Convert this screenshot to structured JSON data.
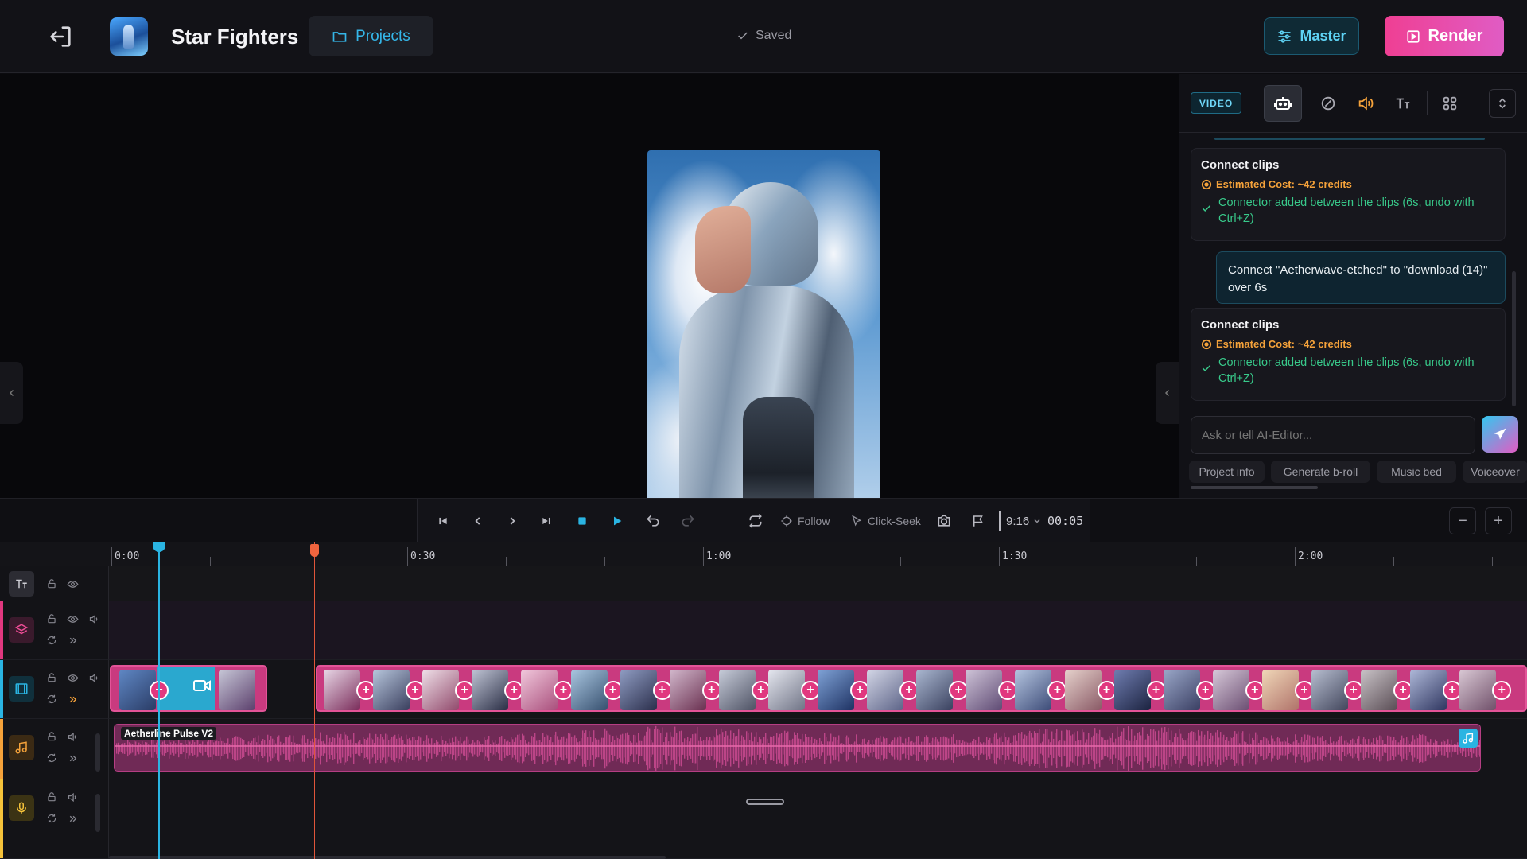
{
  "header": {
    "title": "Star Fighters",
    "projects_label": "Projects",
    "saved_label": "Saved",
    "master_label": "Master",
    "render_label": "Render"
  },
  "side_panel": {
    "active_tab": "VIDEO",
    "tabs": [
      "ai-editor",
      "effects",
      "audio",
      "text",
      "elements"
    ],
    "messages": [
      {
        "type": "system",
        "title": "Connect clips",
        "cost": "Estimated Cost: ~42 credits",
        "result": "Connector added between the clips (6s, undo with Ctrl+Z)"
      },
      {
        "type": "user",
        "text": "Connect \"Aetherwave-etched\" to \"download (14)\" over 6s"
      },
      {
        "type": "system",
        "title": "Connect clips",
        "cost": "Estimated Cost: ~42 credits",
        "result": "Connector added between the clips (6s, undo with Ctrl+Z)"
      }
    ],
    "input_placeholder": "Ask or tell AI-Editor...",
    "suggestions": [
      "Project info",
      "Generate b-roll",
      "Music bed",
      "Voiceover"
    ]
  },
  "transport": {
    "follow_label": "Follow",
    "click_seek_label": "Click-Seek",
    "aspect_ratio": "9:16",
    "time": "00:05"
  },
  "timeline": {
    "ruler_labels": [
      "0:00",
      "0:30",
      "1:00",
      "1:30",
      "2:00"
    ],
    "audio_clip_name": "Aetherline Pulse V2",
    "tracks": [
      "text",
      "overlay",
      "video",
      "music",
      "voice"
    ]
  },
  "colors": {
    "accent_cyan": "#2ab4e2",
    "accent_pink": "#e1387f",
    "cost_orange": "#f5a23a",
    "success_green": "#38c98a"
  }
}
